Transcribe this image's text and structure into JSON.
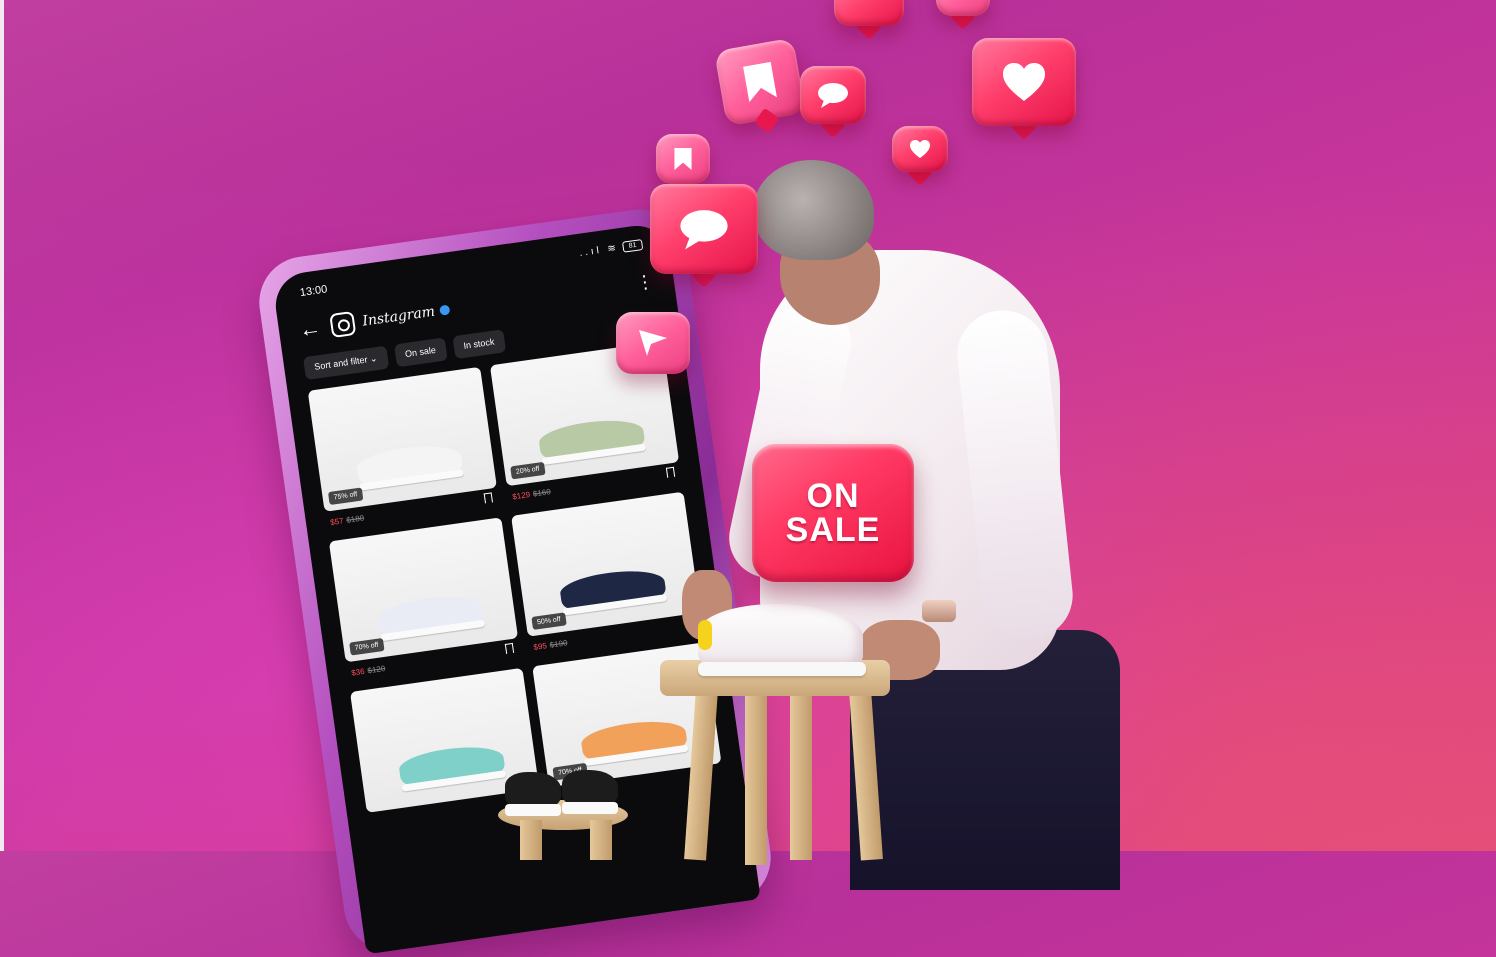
{
  "phone": {
    "status_time": "13:00",
    "status_icons": "..ıl ≋",
    "battery": "81",
    "app_name": "Instagram",
    "back_glyph": "←",
    "menu_glyph": "⋮",
    "chips": [
      "Sort and filter ⌄",
      "On sale",
      "In stock"
    ],
    "products": [
      {
        "discount": "75% off",
        "price": "$57",
        "old_price": "$180",
        "shoe_color": "#f4f4f4"
      },
      {
        "discount": "20% off",
        "price": "$129",
        "old_price": "$160",
        "shoe_color": "#b7c9a5"
      },
      {
        "discount": "70% off",
        "price": "$36",
        "old_price": "$120",
        "shoe_color": "#e9ecf5"
      },
      {
        "discount": "50% off",
        "price": "$95",
        "old_price": "$190",
        "shoe_color": "#1e2744"
      },
      {
        "discount": "",
        "price": "",
        "old_price": "",
        "shoe_color": "#7fd0c8"
      },
      {
        "discount": "70% off",
        "price": "",
        "old_price": "",
        "shoe_color": "#f2a15a"
      }
    ]
  },
  "sale_bubble": {
    "line1": "ON",
    "line2": "SALE"
  },
  "bubble_icons": [
    "bookmark-icon",
    "comment-icon",
    "heart-icon",
    "send-icon"
  ],
  "colors": {
    "background": "#c13fa0",
    "bubble": "#ff3f6c",
    "sale_price": "#ff4d5a"
  }
}
